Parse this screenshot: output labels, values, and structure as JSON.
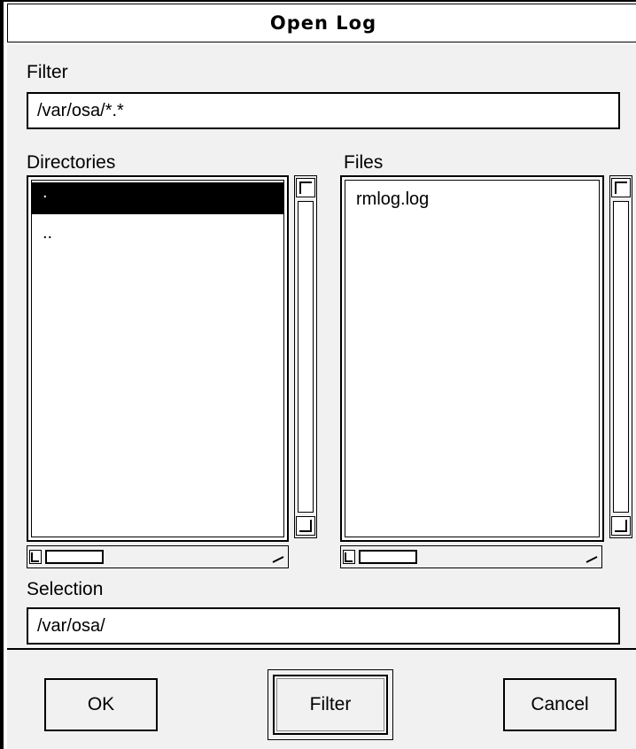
{
  "dialog": {
    "title": "Open Log"
  },
  "filter": {
    "label": "Filter",
    "value": "/var/osa/*.*"
  },
  "directories": {
    "label": "Directories",
    "items": [
      {
        "label": ".",
        "selected": true
      },
      {
        "label": "..",
        "selected": false
      }
    ]
  },
  "files": {
    "label": "Files",
    "items": [
      {
        "label": "rmlog.log",
        "selected": false
      }
    ]
  },
  "selection": {
    "label": "Selection",
    "value": "/var/osa/"
  },
  "buttons": {
    "ok": "OK",
    "filter": "Filter",
    "cancel": "Cancel"
  },
  "icons": {
    "scroll_up": "scroll-up-arrow-icon",
    "scroll_down": "scroll-down-arrow-icon",
    "scroll_left": "scroll-left-arrow-icon",
    "scroll_right": "scroll-right-arrow-icon"
  },
  "colors": {
    "background": "#ffffff",
    "foreground": "#000000",
    "selected_row": "#000000"
  }
}
